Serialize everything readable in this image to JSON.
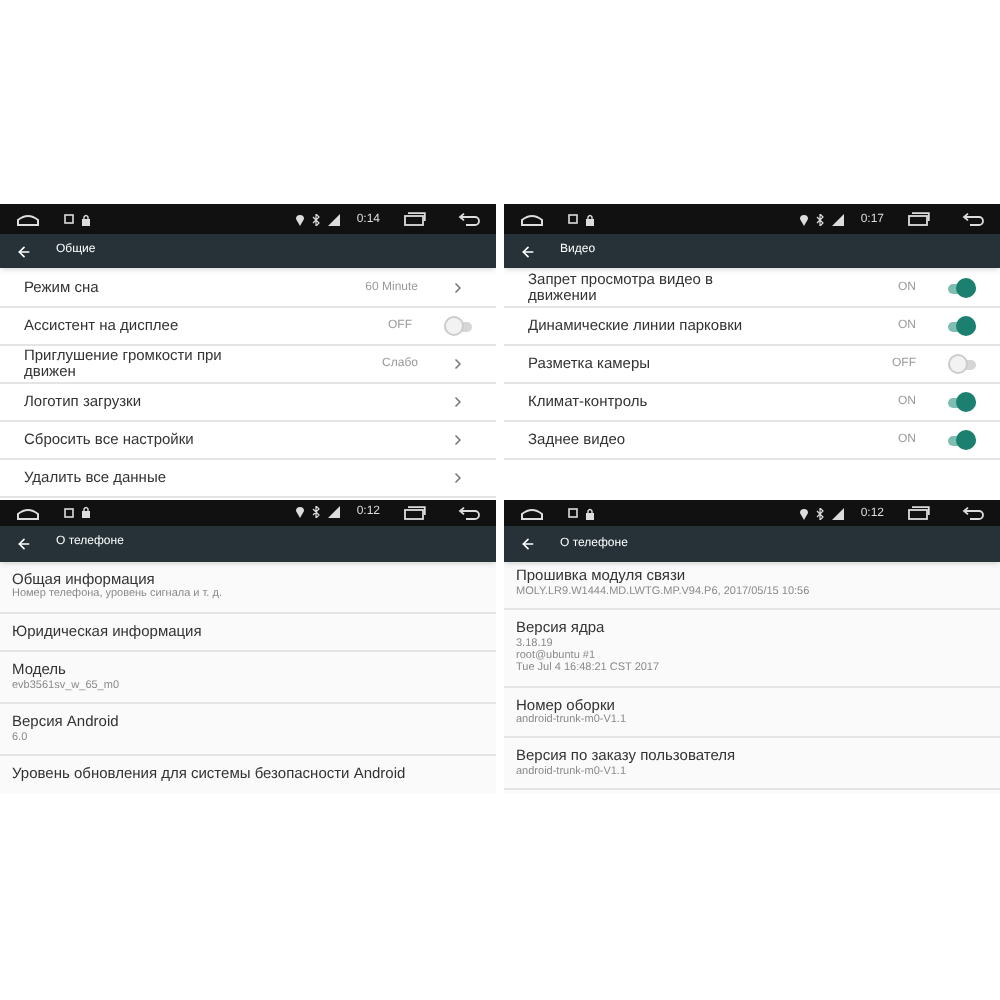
{
  "panels": [
    {
      "time": "0:14",
      "title": "Общие",
      "rows": [
        {
          "kind": "link",
          "label": "Режим сна",
          "value": "60 Minute"
        },
        {
          "kind": "toggle",
          "label": "Ассистент на дисплее",
          "value": "OFF",
          "on": false
        },
        {
          "kind": "link",
          "label": "Приглушение громкости при движен",
          "value": "Слабо"
        },
        {
          "kind": "link",
          "label": "Логотип загрузки"
        },
        {
          "kind": "link",
          "label": "Сбросить все настройки"
        },
        {
          "kind": "link",
          "label": "Удалить все данные"
        }
      ]
    },
    {
      "time": "0:17",
      "title": "Видео",
      "rows": [
        {
          "kind": "toggle",
          "label": "Запрет просмотра видео в движении",
          "value": "ON",
          "on": true
        },
        {
          "kind": "toggle",
          "label": "Динамические линии парковки",
          "value": "ON",
          "on": true
        },
        {
          "kind": "toggle",
          "label": "Разметка камеры",
          "value": "OFF",
          "on": false
        },
        {
          "kind": "toggle",
          "label": "Климат-контроль",
          "value": "ON",
          "on": true
        },
        {
          "kind": "toggle",
          "label": "Заднее видео",
          "value": "ON",
          "on": true
        }
      ]
    },
    {
      "time": "0:12",
      "title": "О телефоне",
      "rows": [
        {
          "kind": "info",
          "label": "Общая информация",
          "lines": [
            "Номер телефона, уровень сигнала и т. д."
          ]
        },
        {
          "kind": "info",
          "label": "Юридическая информация"
        },
        {
          "kind": "info",
          "label": "Модель",
          "lines": [
            "evb3561sv_w_65_m0"
          ]
        },
        {
          "kind": "info",
          "label": "Версия Android",
          "lines": [
            "6.0"
          ]
        },
        {
          "kind": "info",
          "label": "Уровень обновления для системы безопасности Android"
        }
      ]
    },
    {
      "time": "0:12",
      "title": "О телефоне",
      "rows": [
        {
          "kind": "info",
          "label": "Прошивка модуля связи",
          "lines": [
            "MOLY.LR9.W1444.MD.LWTG.MP.V94.P6, 2017/05/15 10:56"
          ]
        },
        {
          "kind": "info",
          "label": "Версия ядра",
          "lines": [
            "3.18.19",
            "root@ubuntu #1",
            "Tue Jul 4 16:48:21 CST 2017"
          ]
        },
        {
          "kind": "info",
          "label": "Номер оборки",
          "lines": [
            "android-trunk-m0-V1.1"
          ]
        },
        {
          "kind": "info",
          "label": "Версия по заказу пользователя",
          "lines": [
            "android-trunk-m0-V1.1"
          ]
        }
      ]
    }
  ]
}
